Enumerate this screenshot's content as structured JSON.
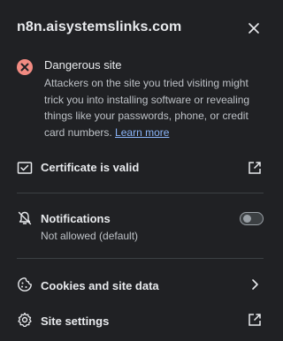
{
  "colors": {
    "background": "#202124",
    "text": "#e8eaed",
    "secondary_text": "#bdc1c6",
    "danger": "#f28b82",
    "link": "#8ab4f8",
    "divider": "#3c4043"
  },
  "header": {
    "site": "n8n.aisystemslinks.com"
  },
  "warning": {
    "title": "Dangerous site",
    "description": "Attackers on the site you tried visiting might trick you into installing software or revealing things like your passwords, phone, or credit card numbers.",
    "link": "Learn more"
  },
  "certificate": {
    "label": "Certificate is valid"
  },
  "notifications": {
    "label": "Notifications",
    "status": "Not allowed (default)",
    "enabled": false
  },
  "cookies": {
    "label": "Cookies and site data"
  },
  "site_settings": {
    "label": "Site settings"
  }
}
